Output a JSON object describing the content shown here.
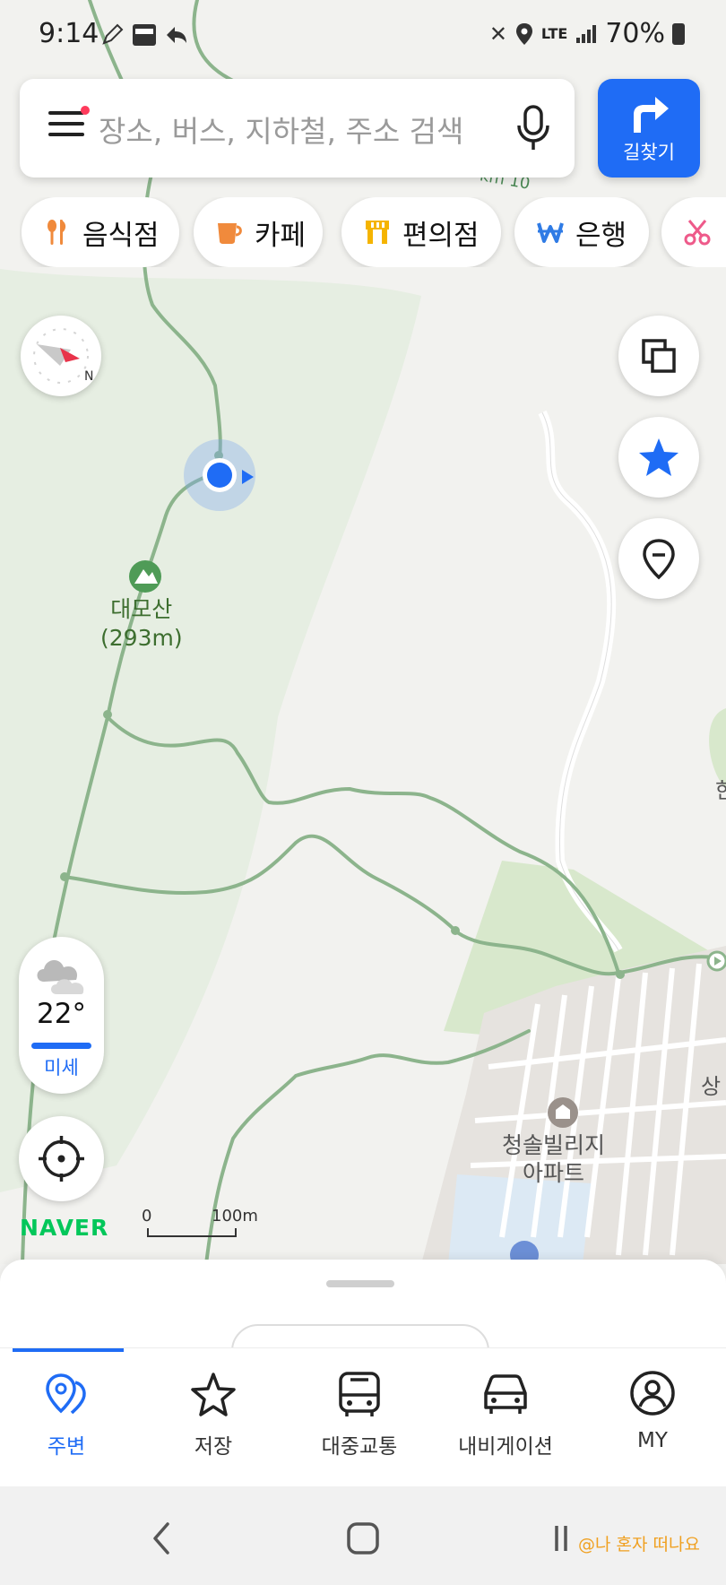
{
  "status_bar": {
    "time": "9:14",
    "network": "LTE",
    "battery": "70%"
  },
  "search": {
    "placeholder": "장소, 버스, 지하철, 주소 검색"
  },
  "route_button": {
    "label": "길찾기"
  },
  "categories": [
    {
      "label": "음식점",
      "icon": "fork-knife-icon",
      "color": "#f08a3c"
    },
    {
      "label": "카페",
      "icon": "coffee-cup-icon",
      "color": "#f08a3c"
    },
    {
      "label": "편의점",
      "icon": "store-icon",
      "color": "#f5b400"
    },
    {
      "label": "은행",
      "icon": "won-icon",
      "color": "#2f7be5"
    },
    {
      "label": "",
      "icon": "scissors-icon",
      "color": "#ee5a8a"
    }
  ],
  "map": {
    "peak_name": "대모산\n(293m)",
    "apartment_name": "청솔빌리지\n아파트",
    "road_marker": "km 10",
    "edge_labels": [
      "한",
      "상"
    ]
  },
  "weather": {
    "icon": "cloud-icon",
    "temperature": "22°",
    "dust": "미세",
    "dust_color": "#1f6cf5"
  },
  "map_brand": "NAVER",
  "scale": {
    "zero": "0",
    "distance": "100m"
  },
  "bottom_nav": [
    {
      "label": "주변",
      "icon": "location-pin-icon",
      "active": true
    },
    {
      "label": "저장",
      "icon": "star-outline-icon",
      "active": false
    },
    {
      "label": "대중교통",
      "icon": "bus-icon",
      "active": false
    },
    {
      "label": "내비게이션",
      "icon": "car-icon",
      "active": false
    },
    {
      "label": "MY",
      "icon": "user-circle-icon",
      "active": false
    }
  ],
  "watermark": "@나 혼자 떠나요",
  "colors": {
    "accent": "#1f6cf5",
    "trail": "#8cb48c",
    "park": "#dfecd6",
    "naver_green": "#03c75a"
  }
}
